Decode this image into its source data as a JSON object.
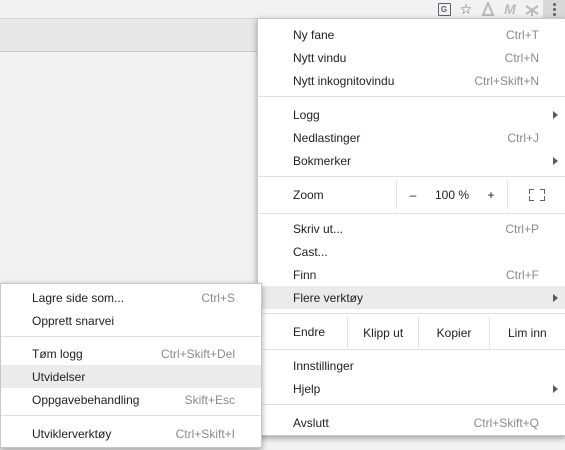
{
  "toolbar": {
    "icons": [
      "translate-icon",
      "star-icon",
      "pdf-extension-icon",
      "gmail-extension-icon",
      "scissors-extension-icon",
      "kebab-menu-icon"
    ],
    "translate_glyph": "G",
    "gmail_glyph": "M"
  },
  "menu": {
    "new_tab": {
      "label": "Ny fane",
      "shortcut": "Ctrl+T"
    },
    "new_window": {
      "label": "Nytt vindu",
      "shortcut": "Ctrl+N"
    },
    "incognito": {
      "label": "Nytt inkognitovindu",
      "shortcut": "Ctrl+Skift+N"
    },
    "history": {
      "label": "Logg"
    },
    "downloads": {
      "label": "Nedlastinger",
      "shortcut": "Ctrl+J"
    },
    "bookmarks": {
      "label": "Bokmerker"
    },
    "zoom": {
      "label": "Zoom",
      "minus": "–",
      "value": "100 %",
      "plus": "+"
    },
    "print": {
      "label": "Skriv ut...",
      "shortcut": "Ctrl+P"
    },
    "cast": {
      "label": "Cast..."
    },
    "find": {
      "label": "Finn",
      "shortcut": "Ctrl+F"
    },
    "more_tools": {
      "label": "Flere verktøy"
    },
    "edit": {
      "label": "Endre",
      "cut": "Klipp ut",
      "copy": "Kopier",
      "paste": "Lim inn"
    },
    "settings": {
      "label": "Innstillinger"
    },
    "help": {
      "label": "Hjelp"
    },
    "exit": {
      "label": "Avslutt",
      "shortcut": "Ctrl+Skift+Q"
    }
  },
  "submenu": {
    "save_page": {
      "label": "Lagre side som...",
      "shortcut": "Ctrl+S"
    },
    "create_shortcut": {
      "label": "Opprett snarvei"
    },
    "clear_history": {
      "label": "Tøm logg",
      "shortcut": "Ctrl+Skift+Del"
    },
    "extensions": {
      "label": "Utvidelser"
    },
    "task_manager": {
      "label": "Oppgavebehandling",
      "shortcut": "Skift+Esc"
    },
    "developer_tools": {
      "label": "Utviklerverktøy",
      "shortcut": "Ctrl+Skift+I"
    }
  }
}
